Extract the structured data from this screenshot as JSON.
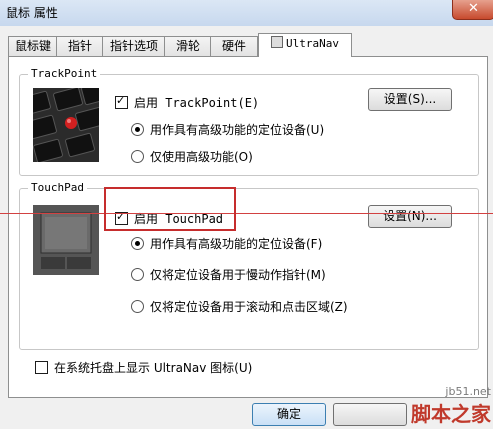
{
  "window": {
    "title": "鼠标 属性",
    "close_glyph": "✕"
  },
  "tabs": [
    {
      "label": "鼠标键"
    },
    {
      "label": "指针"
    },
    {
      "label": "指针选项"
    },
    {
      "label": "滑轮"
    },
    {
      "label": "硬件"
    },
    {
      "label": "UltraNav"
    }
  ],
  "trackpoint": {
    "group_title": "TrackPoint",
    "enable_label": "启用 TrackPoint(E)",
    "settings_button": "设置(S)...",
    "option_advanced": "用作具有高级功能的定位设备(U)",
    "option_basic": "仅使用高级功能(O)"
  },
  "touchpad": {
    "group_title": "TouchPad",
    "enable_label": "启用 TouchPad",
    "settings_button": "设置(N)...",
    "option_advanced": "用作具有高级功能的定位设备(F)",
    "option_pointer_only": "仅将定位设备用于慢动作指针(M)",
    "option_scroll_click": "仅将定位设备用于滚动和点击区域(Z)"
  },
  "systray": {
    "label": "在系统托盘上显示 UltraNav 图标(U)"
  },
  "footer": {
    "ok_button": "确定"
  },
  "watermark": {
    "url": "jb51.net",
    "brand": "脚本之家"
  },
  "colors": {
    "highlight_red": "#c62d2d",
    "accent_blue": "#3c7fb1"
  }
}
